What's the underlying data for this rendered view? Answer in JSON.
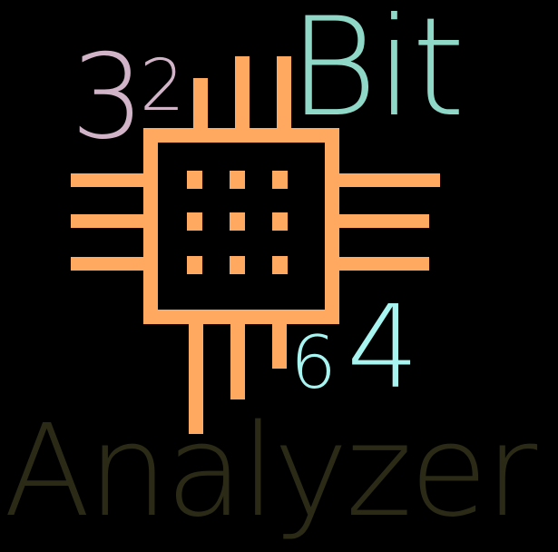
{
  "logo": {
    "number_32_digit_3": "3",
    "number_32_digit_2": "2",
    "word_bit": "Bit",
    "number_64_digit_6": "6",
    "number_64_digit_4": "4",
    "word_analyzer": "Analyzer"
  },
  "colors": {
    "background": "#000000",
    "chip": "#ffa860",
    "text_32": "#d2b4c8",
    "text_bit": "#8fd8c8",
    "text_64": "#a8f4f0",
    "text_analyzer": "#2b2a17"
  },
  "icons": {
    "chip": "microchip-icon"
  }
}
